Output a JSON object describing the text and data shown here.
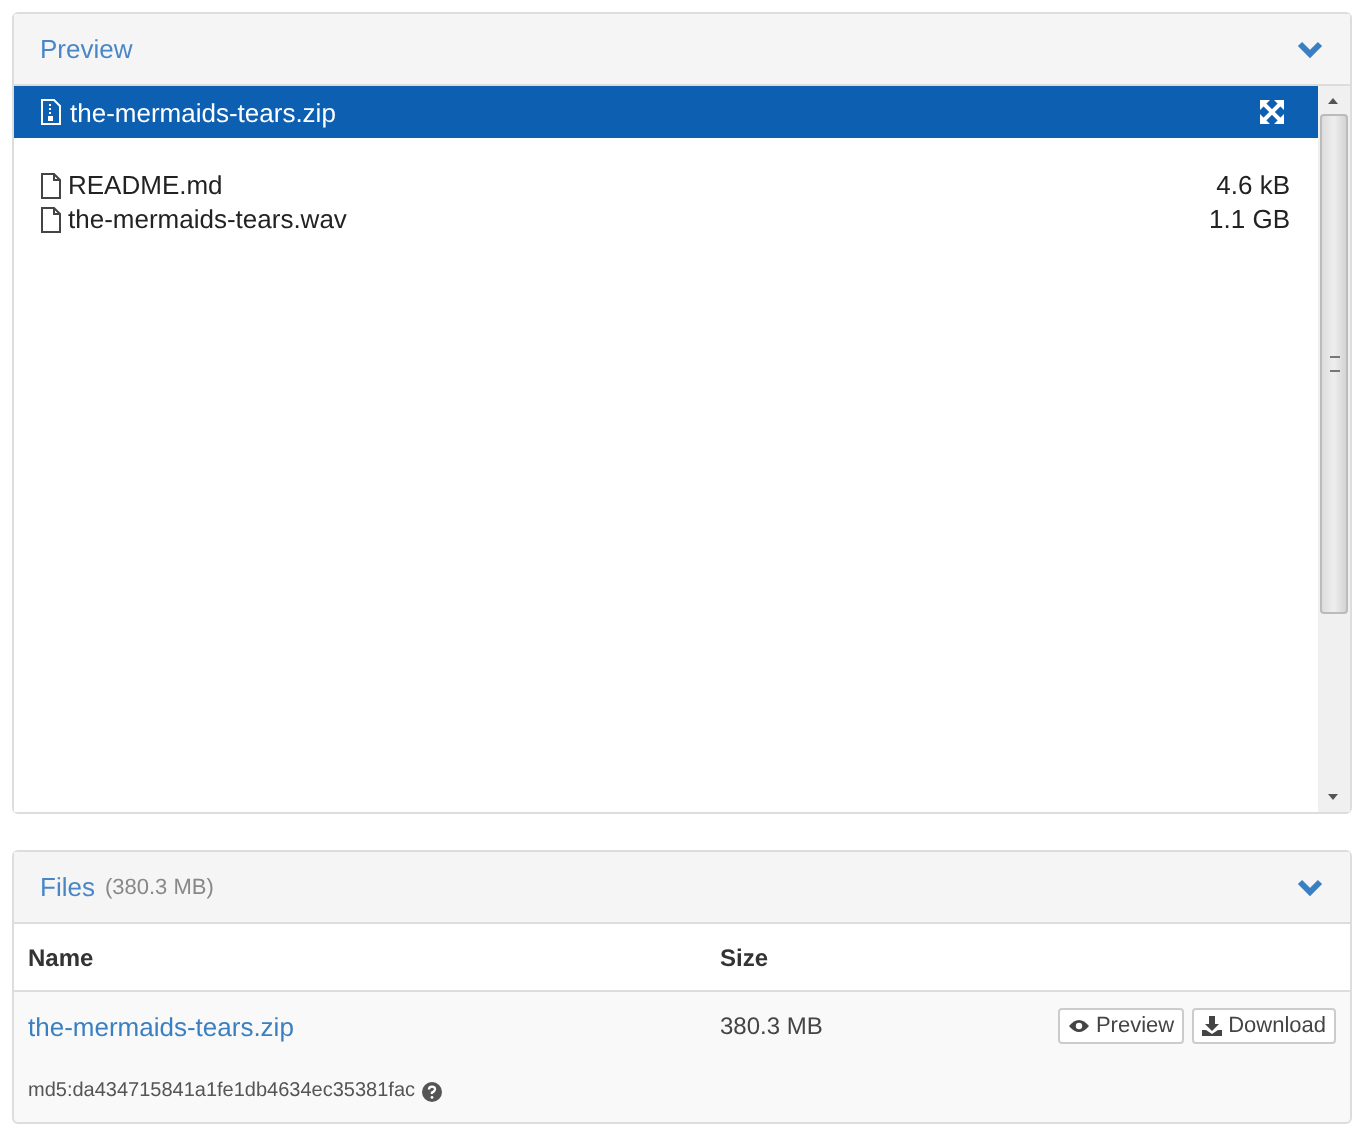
{
  "preview": {
    "title": "Preview",
    "archive": {
      "name": "the-mermaids-tears.zip"
    },
    "files": [
      {
        "name": "README.md",
        "size": "4.6 kB"
      },
      {
        "name": "the-mermaids-tears.wav",
        "size": "1.1 GB"
      }
    ]
  },
  "files_panel": {
    "title": "Files",
    "total": "(380.3 MB)",
    "columns": [
      "Name",
      "Size"
    ],
    "rows": [
      {
        "name": "the-mermaids-tears.zip",
        "size": "380.3 MB",
        "buttons": [
          "Preview",
          "Download"
        ],
        "checksum": "md5:da434715841a1fe1db4634ec35381fac"
      }
    ]
  }
}
